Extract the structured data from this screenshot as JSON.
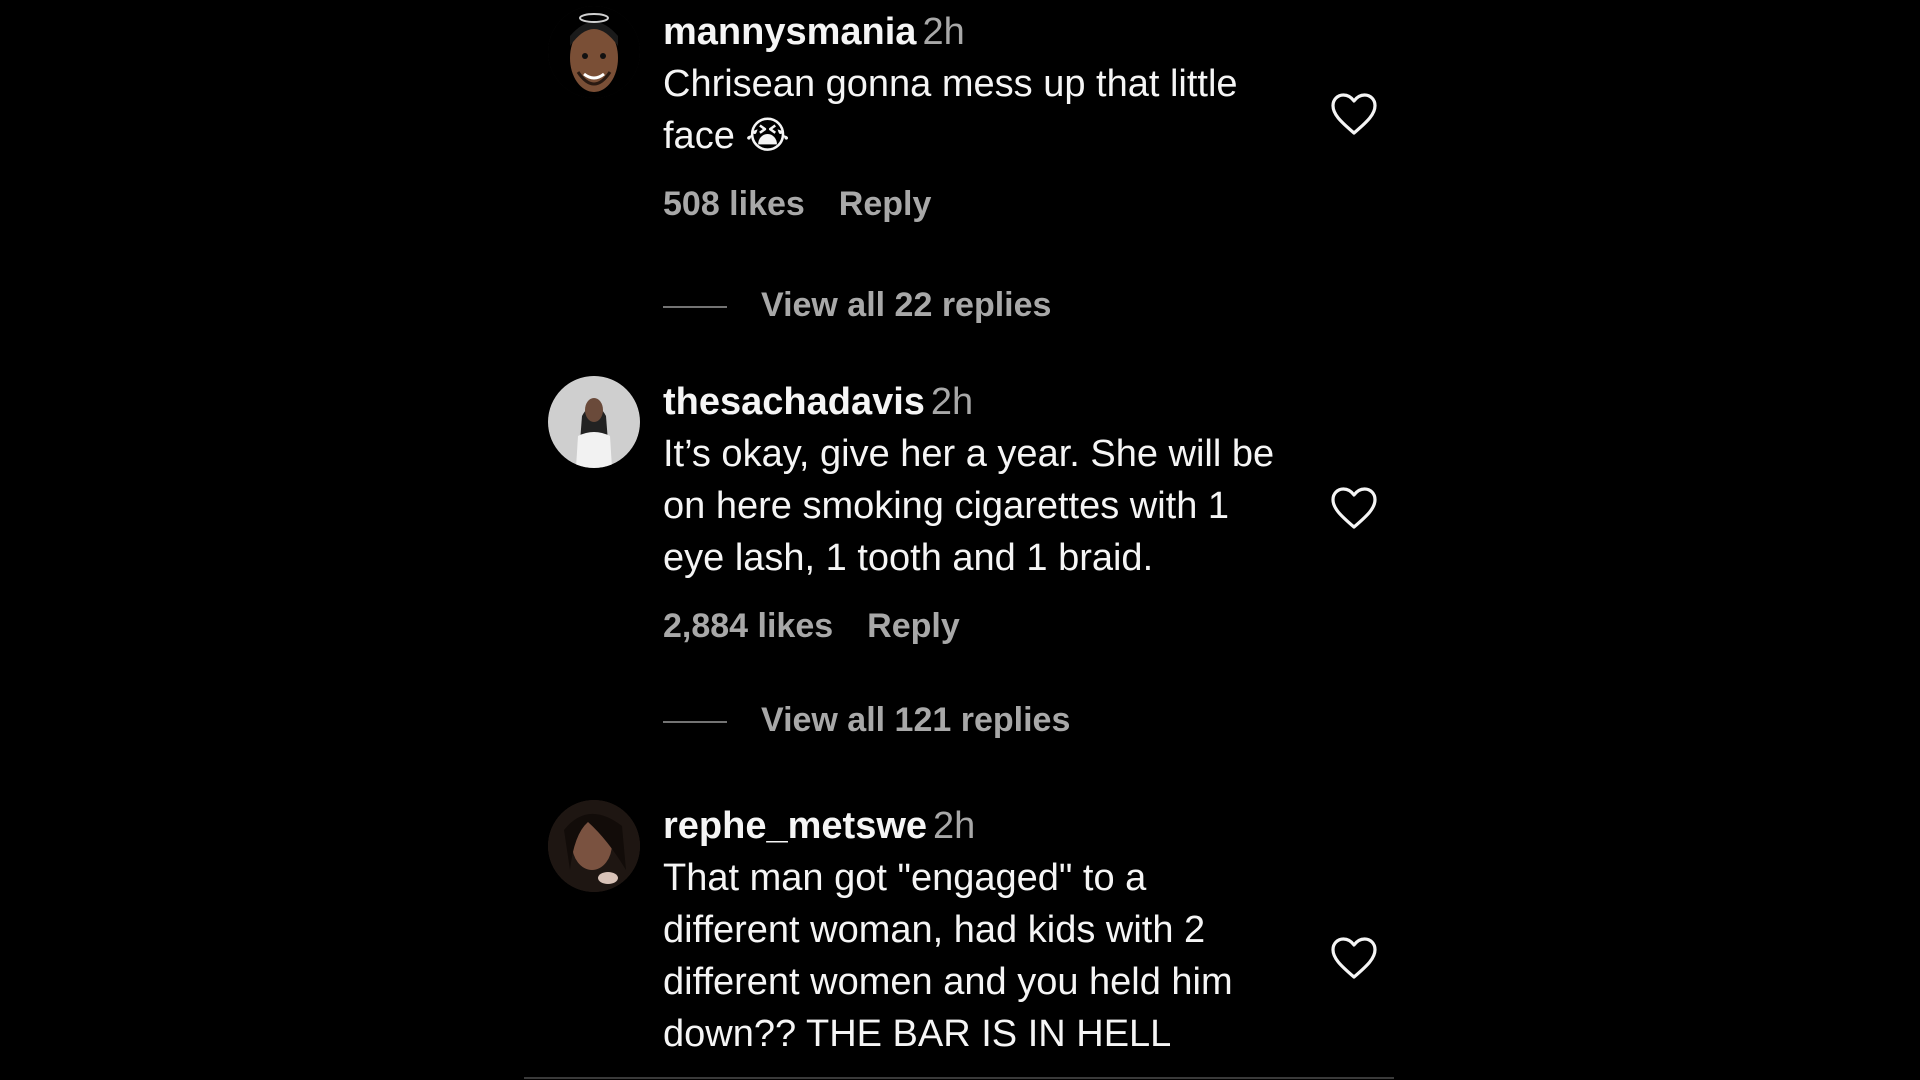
{
  "comments": [
    {
      "username": "mannysmania",
      "time": "2h",
      "text": "Chrisean gonna mess up that little\nface",
      "emoji": "😭",
      "likes": "508 likes",
      "reply": "Reply",
      "view_replies": "View all 22 replies"
    },
    {
      "username": "thesachadavis",
      "time": "2h",
      "text": "It’s okay, give her a year. She will be\non here smoking cigarettes with 1\neye lash, 1 tooth and 1 braid.",
      "likes": "2,884 likes",
      "reply": "Reply",
      "view_replies": "View all 121 replies"
    },
    {
      "username": "rephe_metswe",
      "time": "2h",
      "text": "That man got \"engaged\" to a\ndifferent woman, had kids with 2\ndifferent women and you held him\ndown?? THE BAR IS IN HELL"
    }
  ],
  "icons": {
    "heart": "heart-outline-icon"
  },
  "colors": {
    "background": "#000000",
    "primary_text": "#f5f5f5",
    "secondary_text": "#a8a8a8"
  }
}
